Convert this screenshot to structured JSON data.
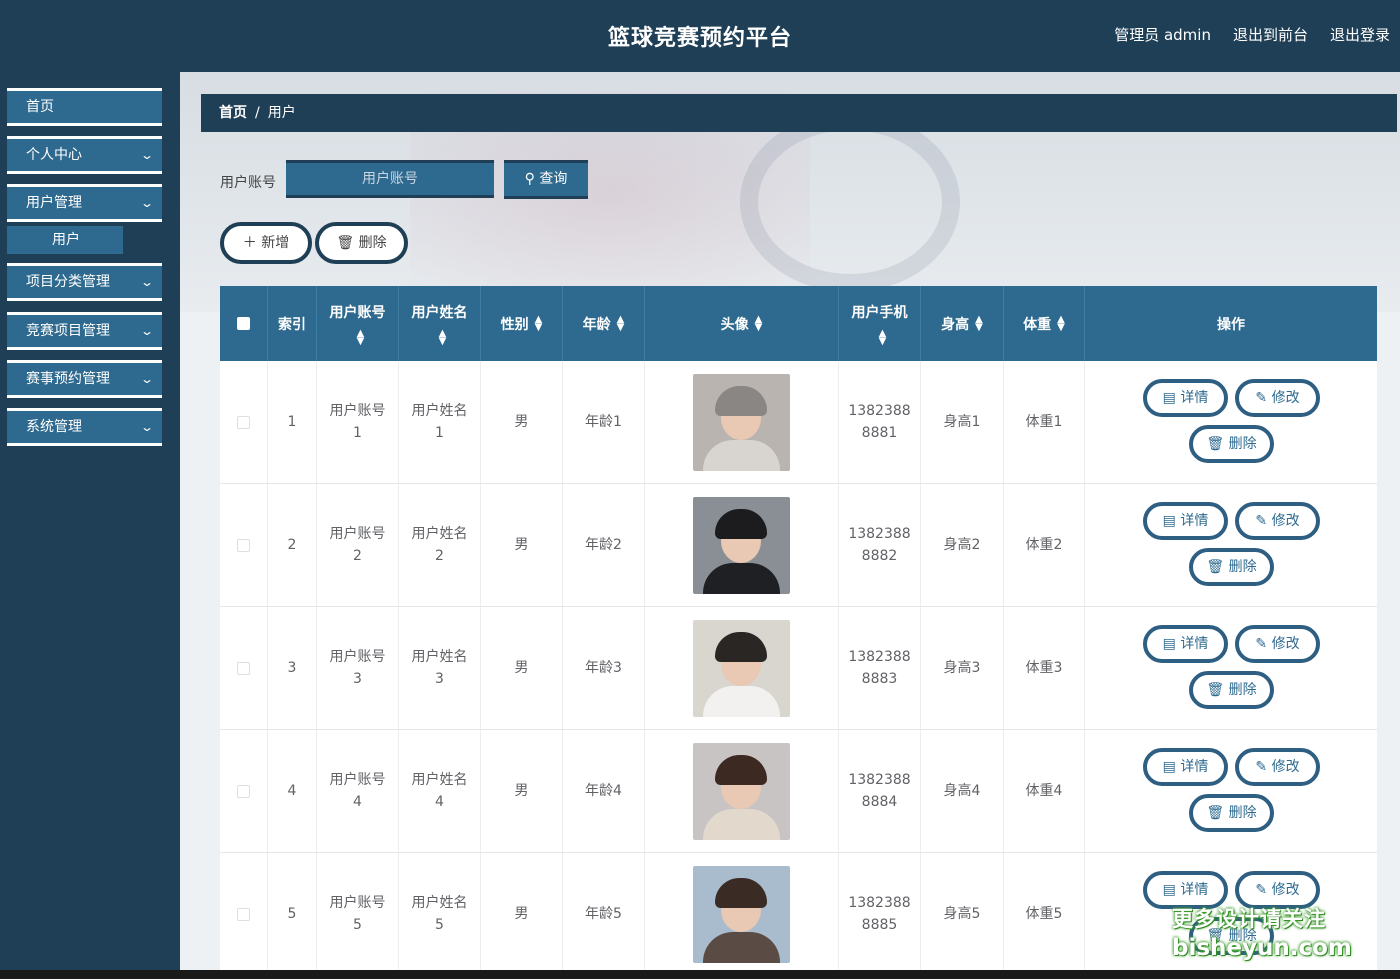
{
  "header": {
    "title": "篮球竞赛预约平台",
    "admin_label": "管理员 admin",
    "front_link": "退出到前台",
    "logout_link": "退出登录"
  },
  "sidebar": {
    "items": [
      {
        "label": "首页",
        "has_arrow": false
      },
      {
        "label": "个人中心",
        "has_arrow": true
      },
      {
        "label": "用户管理",
        "has_arrow": true
      },
      {
        "label": "项目分类管理",
        "has_arrow": true
      },
      {
        "label": "竞赛项目管理",
        "has_arrow": true
      },
      {
        "label": "赛事预约管理",
        "has_arrow": true
      },
      {
        "label": "系统管理",
        "has_arrow": true
      }
    ],
    "sub_item": "用户"
  },
  "breadcrumb": {
    "home": "首页",
    "sep": "/",
    "current": "用户"
  },
  "search": {
    "label": "用户账号",
    "placeholder": "用户账号",
    "button": "查询",
    "button_icon": "search-icon"
  },
  "actions": {
    "add": "新增",
    "delete": "删除"
  },
  "table": {
    "headers": [
      "索引",
      "用户账号",
      "用户姓名",
      "性别",
      "年龄",
      "头像",
      "用户手机",
      "身高",
      "体重",
      "操作"
    ],
    "rows": [
      {
        "index": "1",
        "account_1": "用户账号",
        "account_2": "1",
        "name_1": "用户姓名",
        "name_2": "1",
        "gender": "男",
        "age": "年龄1",
        "phone_1": "1382388",
        "phone_2": "8881",
        "height": "身高1",
        "weight": "体重1",
        "avatar": "avatar-hooded-boy"
      },
      {
        "index": "2",
        "account_1": "用户账号",
        "account_2": "2",
        "name_1": "用户姓名",
        "name_2": "2",
        "gender": "男",
        "age": "年龄2",
        "phone_1": "1382388",
        "phone_2": "8882",
        "height": "身高2",
        "weight": "体重2",
        "avatar": "avatar-dark-hair-boy"
      },
      {
        "index": "3",
        "account_1": "用户账号",
        "account_2": "3",
        "name_1": "用户姓名",
        "name_2": "3",
        "gender": "男",
        "age": "年龄3",
        "phone_1": "1382388",
        "phone_2": "8883",
        "height": "身高3",
        "weight": "体重3",
        "avatar": "avatar-car-selfie-boy"
      },
      {
        "index": "4",
        "account_1": "用户账号",
        "account_2": "4",
        "name_1": "用户姓名",
        "name_2": "4",
        "gender": "男",
        "age": "年龄4",
        "phone_1": "1382388",
        "phone_2": "8884",
        "height": "身高4",
        "weight": "体重4",
        "avatar": "avatar-long-hair-girl"
      },
      {
        "index": "5",
        "account_1": "用户账号",
        "account_2": "5",
        "name_1": "用户姓名",
        "name_2": "5",
        "gender": "男",
        "age": "年龄5",
        "phone_1": "1382388",
        "phone_2": "8885",
        "height": "身高5",
        "weight": "体重5",
        "avatar": "avatar-seaside-girl"
      }
    ],
    "row_actions": {
      "detail": "详情",
      "edit": "修改",
      "delete": "删除"
    }
  },
  "watermark": {
    "line1": "更多设计请关注",
    "line2": "bisheyun.com"
  },
  "colors": {
    "dark": "#1f3f56",
    "primary": "#2e6a8f",
    "accent_text": "#2e6a8f"
  }
}
